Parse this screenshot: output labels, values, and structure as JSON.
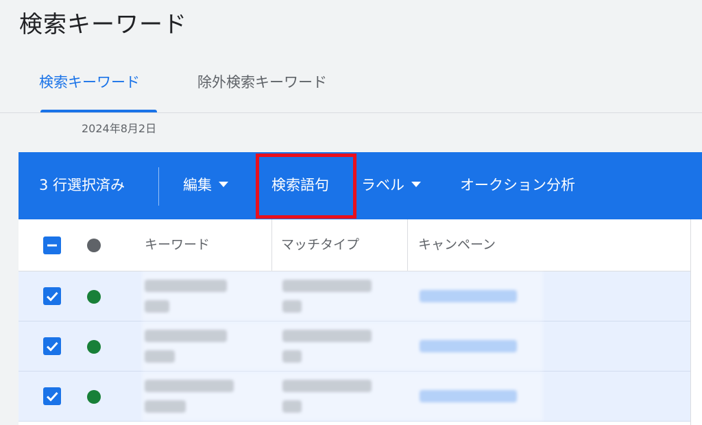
{
  "page": {
    "title": "検索キーワード",
    "date": "2024年8月2日"
  },
  "tabs": [
    {
      "label": "検索キーワード",
      "active": true
    },
    {
      "label": "除外検索キーワード",
      "active": false
    }
  ],
  "action_bar": {
    "selected_count": "3 行選択済み",
    "edit": "編集",
    "search_terms": "検索語句",
    "label": "ラベル",
    "auction_insights": "オークション分析"
  },
  "table": {
    "columns": [
      "キーワード",
      "マッチタイプ",
      "キャンペーン"
    ],
    "header_checkbox_state": "indeterminate",
    "header_status_color": "#5f6368",
    "rows": [
      {
        "selected": true,
        "status_color": "#188038"
      },
      {
        "selected": true,
        "status_color": "#188038"
      },
      {
        "selected": true,
        "status_color": "#188038"
      }
    ]
  },
  "colors": {
    "primary": "#1a73e8",
    "highlight_box": "#e8101d",
    "row_selected_bg": "#e8f0fe"
  },
  "icons": [
    "checkbox-indeterminate-icon",
    "checkbox-checked-icon",
    "status-dot-icon",
    "caret-down-icon"
  ]
}
